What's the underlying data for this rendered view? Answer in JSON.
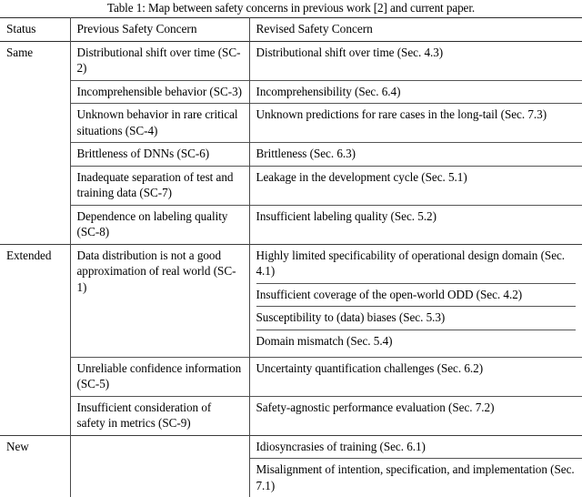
{
  "caption": "Table 1: Map between safety concerns in previous work [2] and current paper.",
  "table": {
    "headers": {
      "status": "Status",
      "previous": "Previous Safety Concern",
      "revised": "Revised Safety Concern"
    },
    "groups": [
      {
        "status": "Same",
        "rows": [
          {
            "previous": "Distributional shift over time (SC-2)",
            "revised": "Distributional shift over time (Sec. 4.3)"
          },
          {
            "previous": "Incomprehensible behavior (SC-3)",
            "revised": "Incomprehensibility (Sec. 6.4)"
          },
          {
            "previous": "Unknown behavior in rare critical situations (SC-4)",
            "revised": "Unknown predictions for rare cases in the long-tail (Sec. 7.3)"
          },
          {
            "previous": "Brittleness of DNNs (SC-6)",
            "revised": "Brittleness (Sec. 6.3)"
          },
          {
            "previous": "Inadequate separation of test and training data (SC-7)",
            "revised": "Leakage in the development cycle (Sec. 5.1)"
          },
          {
            "previous": "Dependence on labeling quality (SC-8)",
            "revised": "Insufficient labeling quality (Sec. 5.2)"
          }
        ]
      },
      {
        "status": "Extended",
        "rows": [
          {
            "previous": "Data distribution is not a good approximation of real world (SC-1)",
            "revised_multi": [
              "Highly limited specificability of operational design domain (Sec. 4.1)",
              "Insufficient coverage of the open-world ODD (Sec. 4.2)",
              "Susceptibility to (data) biases (Sec. 5.3)",
              "Domain mismatch (Sec. 5.4)"
            ]
          },
          {
            "previous": "Unreliable confidence information (SC-5)",
            "revised": "Uncertainty quantification challenges (Sec. 6.2)"
          },
          {
            "previous": "Insufficient consideration of safety in metrics (SC-9)",
            "revised": "Safety-agnostic performance evaluation (Sec. 7.2)"
          }
        ]
      },
      {
        "status": "New",
        "rows": [
          {
            "previous": "",
            "revised": "Idiosyncrasies of training (Sec. 6.1)"
          },
          {
            "previous": "",
            "revised": "Misalignment of intention, specification, and implementation (Sec. 7.1)"
          }
        ]
      }
    ]
  }
}
